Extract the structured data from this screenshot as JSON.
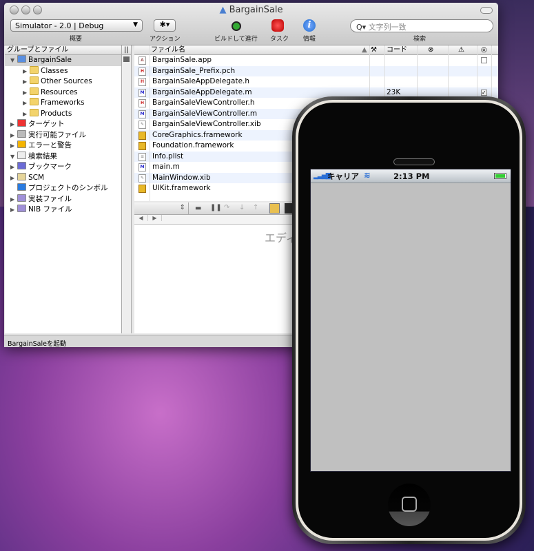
{
  "window": {
    "title": "BargainSale"
  },
  "toolbar": {
    "scheme": "Simulator - 2.0 | Debug",
    "scheme_label": "概要",
    "action_label": "アクション",
    "build_label": "ビルドして進行",
    "task_label": "タスク",
    "info_label": "情報",
    "search_placeholder": "文字列一致",
    "search_label": "検索"
  },
  "sidebar": {
    "header": "グループとファイル",
    "items": [
      {
        "label": "BargainSale",
        "level": 0,
        "expanded": true,
        "icon": "project-icon",
        "selected": true
      },
      {
        "label": "Classes",
        "level": 1,
        "icon": "folder-icon"
      },
      {
        "label": "Other Sources",
        "level": 1,
        "icon": "folder-icon"
      },
      {
        "label": "Resources",
        "level": 1,
        "icon": "folder-icon"
      },
      {
        "label": "Frameworks",
        "level": 1,
        "icon": "folder-icon"
      },
      {
        "label": "Products",
        "level": 1,
        "icon": "folder-icon"
      },
      {
        "label": "ターゲット",
        "level": 0,
        "icon": "target-icon"
      },
      {
        "label": "実行可能ファイル",
        "level": 0,
        "icon": "executable-icon"
      },
      {
        "label": "エラーと警告",
        "level": 0,
        "icon": "warning-icon"
      },
      {
        "label": "検索結果",
        "level": 0,
        "expanded": true,
        "icon": "search-icon"
      },
      {
        "label": "ブックマーク",
        "level": 0,
        "icon": "bookmark-icon"
      },
      {
        "label": "SCM",
        "level": 0,
        "icon": "scm-icon"
      },
      {
        "label": "プロジェクトのシンボル",
        "level": 0,
        "noarrow": true,
        "icon": "symbols-icon"
      },
      {
        "label": "実装ファイル",
        "level": 0,
        "icon": "smart-folder-icon"
      },
      {
        "label": "NIB ファイル",
        "level": 0,
        "icon": "smart-folder-icon"
      }
    ]
  },
  "files": {
    "headers": {
      "name": "ファイル名",
      "code": "コード"
    },
    "rows": [
      {
        "name": "BargainSale.app",
        "type": "app",
        "checkbox": true
      },
      {
        "name": "BargainSale_Prefix.pch",
        "type": "H"
      },
      {
        "name": "BargainSaleAppDelegate.h",
        "type": "H"
      },
      {
        "name": "BargainSaleAppDelegate.m",
        "type": "M",
        "code": "23K",
        "checked": true
      },
      {
        "name": "BargainSaleViewController.h",
        "type": "H"
      },
      {
        "name": "BargainSaleViewController.m",
        "type": "M"
      },
      {
        "name": "BargainSaleViewController.xib",
        "type": "xib"
      },
      {
        "name": "CoreGraphics.framework",
        "type": "framework"
      },
      {
        "name": "Foundation.framework",
        "type": "framework"
      },
      {
        "name": "Info.plist",
        "type": "plist"
      },
      {
        "name": "main.m",
        "type": "M"
      },
      {
        "name": "MainWindow.xib",
        "type": "xib"
      },
      {
        "name": "UIKit.framework",
        "type": "framework"
      }
    ]
  },
  "editor": {
    "placeholder": "エディ"
  },
  "statusbar": {
    "text": "BargainSaleを起動"
  },
  "iphone": {
    "carrier": "キャリア",
    "time": "2:13 PM",
    "battery": 1.0
  }
}
